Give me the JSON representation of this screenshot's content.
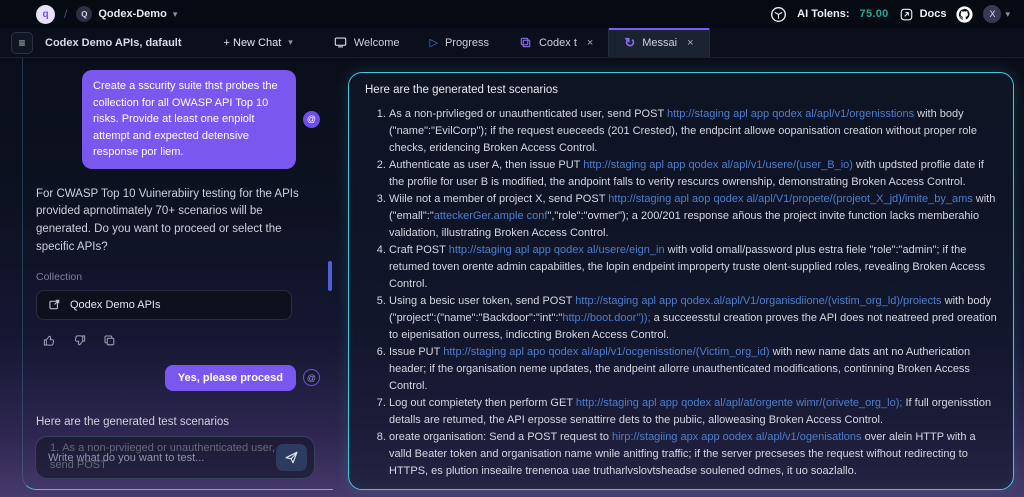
{
  "topbar": {
    "logo_letter": "q",
    "separator": "/",
    "workspace_letter": "Q",
    "workspace": "Qodex-Demo",
    "tokens_label": "AI Tolens:",
    "tokens_value": "75.00",
    "docs_label": "Docs",
    "avatar_letter": "X"
  },
  "tabbar": {
    "collection_label": "Codex Demo APIs, dafault",
    "new_chat_label": "+ New Chat",
    "tabs": [
      {
        "label": "Welcome"
      },
      {
        "label": "Progress"
      },
      {
        "label": "Codex t",
        "closable": true
      },
      {
        "label": "Messai",
        "closable": true,
        "active": true
      }
    ]
  },
  "chat": {
    "user_message_1": "Create a sscurity suite thst probes the collection for all OWASP API Top 10 risks. Provide at least one enpiolt attempt and expected detensive response por liem.",
    "assistant_message_1": "For CWASP Top 10 Vuinerabiiry testing for the APIs provided aprnotimately 70+ scenarios will be generated. Do you want to proceed or select the specific APIs?",
    "collection_label": "Collection",
    "collection_name": "Qodex Demo APIs",
    "user_message_2": "Yes, please procesd",
    "assistant_message_2": "Here are the generated test scenarios",
    "scenario_preview_number": "1.",
    "scenario_preview": "As a non-prviieged or unauthenticated user, send POST",
    "input_placeholder": "Write what do you want to test..."
  },
  "results": {
    "title": "Here are the generated test scenarios",
    "scenarios": [
      {
        "segments": [
          {
            "text": "As a non-privlieged or unauthenticated user, send POST "
          },
          {
            "text": "http://staging apl app qodex al/apl/v1/orgenisstions",
            "link": true
          },
          {
            "text": " with body (\"name\":\"EvilCorp\"); if the request eueceeds (201 Crested), the endpcint allowe oopanisation creation without proper role checks, eridencing Broken Access Control."
          }
        ]
      },
      {
        "segments": [
          {
            "text": "Authenticate as user A, then issue PUT "
          },
          {
            "text": "http://staging apl app qodex al/apl/v1/usere/(user_B_io)",
            "link": true
          },
          {
            "text": " with updsted proflie date if the profile for user B is modified, the andpoint falls to verity rescurcs owrenship, demonstrating Broken Access Control."
          }
        ]
      },
      {
        "segments": [
          {
            "text": "Wiile not a member of project X, send POST "
          },
          {
            "text": "http://staging apl aop qodex al/apl/V1/propete/(projeot_X_jd)/imite_by_ams",
            "link": true
          },
          {
            "text": " with (\"emall\":\""
          },
          {
            "text": "atteckerGer.ample conf",
            "link": true
          },
          {
            "text": "\",\"role\":\"ovmer\"); a 200/201 response añous the project invite function lacks memberahio validation, illustrating Broken Access Control."
          }
        ]
      },
      {
        "segments": [
          {
            "text": "Craft POST "
          },
          {
            "text": "http://staging apl app qodex al/usere/eign_in",
            "link": true
          },
          {
            "text": " with volid omall/password plus estra fiele \"role\":\"admin\"; if the retumed toven orente admin capabiitles, the lopin endpeint improperty truste olent-supplied roles, revealing Broken Access Control."
          }
        ]
      },
      {
        "segments": [
          {
            "text": "Using a besic user token, send POST "
          },
          {
            "text": "http://staging apl app qodex.al/apl/V1/organisdiione/(vistim_org_ld)/proiects",
            "link": true
          },
          {
            "text": " with body (\"project\":(\"name\":\"Backdoor\":\"int\":\""
          },
          {
            "text": "http://boot.door\"));",
            "link": true
          },
          {
            "text": " a succeesstul creation proves the API does not neatreed pred oreation to eipenisation ourress, indiccting Broken Access Control."
          }
        ]
      },
      {
        "segments": [
          {
            "text": "Issue PUT "
          },
          {
            "text": "http://staging apl apo qodex al/apl/v1/ocgenisstione/(Victim_org_id)",
            "link": true
          },
          {
            "text": " with new name dats ant no Autherication header; if the organisation neme updates, the andpeint allorre unauthenticated modifications, continning Broken Access Control."
          }
        ]
      },
      {
        "segments": [
          {
            "text": "Log out compietety then perform GET "
          },
          {
            "text": "http://staging apl app qodex al/apl/at/orgente wimr/(orivete_org_lo);",
            "link": true
          },
          {
            "text": " If full orgenisstion detalls are retumed, the API erposse senattirre dets to the pubiic, alloweasing Broken Access Control."
          }
        ]
      },
      {
        "segments": [
          {
            "text": "oreate organisation: Send a POST request to "
          },
          {
            "text": "hirp://stagiing apx app oodex al/apl/v1/ogenisatlons",
            "link": true
          },
          {
            "text": " over alein HTTP with a valld Beater token and organisation name wnile anitfing traffic; if the server precseses the request wifhout redirecting to HTTPS, es plution inseailre trenenoa uae trutharlvslovtsheadse soulened odmes, it uo soazlallo."
          }
        ]
      }
    ]
  },
  "colors": {
    "accent_purple": "#7a58f0",
    "panel_border_cyan": "#45c4da",
    "link_blue": "#4d7ecf",
    "token_teal": "#2aa795"
  }
}
